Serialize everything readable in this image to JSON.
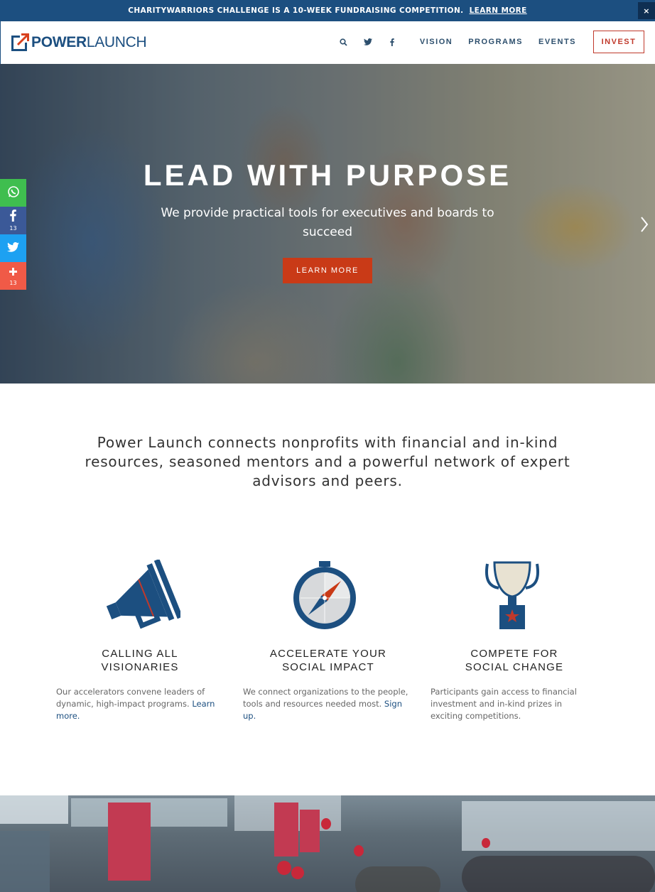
{
  "announcement": {
    "text": "CHARITYWARRIORS CHALLENGE IS A 10-WEEK FUNDRAISING COMPETITION.",
    "link": "LEARN MORE",
    "close": "×"
  },
  "header": {
    "logo_bold": "POWER",
    "logo_light": "LAUNCH",
    "nav": [
      "VISION",
      "PROGRAMS",
      "EVENTS"
    ],
    "invest": "INVEST",
    "icons": [
      "search-icon",
      "twitter-icon",
      "facebook-icon"
    ]
  },
  "hero": {
    "title": "LEAD WITH PURPOSE",
    "subtitle": "We provide practical tools for executives and boards to succeed",
    "button": "LEARN MORE"
  },
  "share": {
    "items": [
      {
        "icon": "whatsapp-icon",
        "count": ""
      },
      {
        "icon": "facebook-icon",
        "count": "13"
      },
      {
        "icon": "twitter-icon",
        "count": ""
      },
      {
        "icon": "plus-icon",
        "count": "13"
      }
    ],
    "colors": [
      "#3fbe4f",
      "#3b5998",
      "#1da1f2",
      "#f05a47"
    ]
  },
  "intro": "Power Launch connects nonprofits with financial and in-kind resources, seasoned mentors and a powerful network of expert advisors and peers.",
  "features": [
    {
      "icon": "megaphone-icon",
      "title_line1": "CALLING ALL",
      "title_line2": "VISIONARIES",
      "desc": "Our accelerators convene leaders of dynamic, high-impact programs.",
      "link": "Learn more."
    },
    {
      "icon": "compass-icon",
      "title_line1": "ACCELERATE YOUR",
      "title_line2": "SOCIAL IMPACT",
      "desc": "We connect organizations to the people, tools and resources needed most.",
      "link": "Sign up."
    },
    {
      "icon": "trophy-icon",
      "title_line1": "COMPETE FOR",
      "title_line2": "SOCIAL CHANGE",
      "desc": "Participants gain access to financial investment and in-kind prizes in exciting competitions.",
      "link": ""
    }
  ],
  "colors": {
    "brand_blue": "#1c4f80",
    "accent_red": "#c93a17",
    "nav_text": "#2d4f6d"
  }
}
